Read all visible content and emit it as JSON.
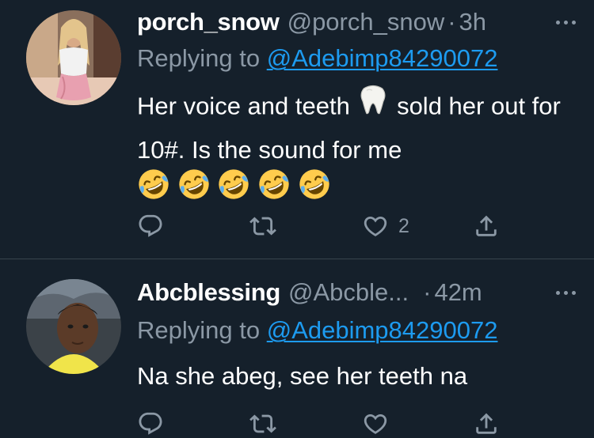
{
  "tweets": [
    {
      "display_name": "porch_snow",
      "handle": "@porch_snow",
      "separator": "·",
      "time": "3h",
      "replying_prefix": "Replying to ",
      "replying_to": "@Adebimp84290072",
      "text_part1": "Her voice and teeth ",
      "text_part2": " sold her out for 10#. Is the sound for me",
      "emojis": [
        "tooth",
        "rolling-on-floor-laughing",
        "rolling-on-floor-laughing",
        "rolling-on-floor-laughing",
        "rolling-on-floor-laughing",
        "rolling-on-floor-laughing"
      ],
      "like_count": "2",
      "icons": [
        "reply-icon",
        "retweet-icon",
        "like-icon",
        "share-icon",
        "more-icon"
      ]
    },
    {
      "display_name": "Abcblessing",
      "handle": "@Abcble...",
      "separator": "·",
      "time": "42m",
      "replying_prefix": "Replying to ",
      "replying_to": "@Adebimp84290072",
      "text": "Na she abeg, see her teeth na",
      "icons": [
        "reply-icon",
        "retweet-icon",
        "like-icon",
        "share-icon",
        "more-icon"
      ]
    }
  ],
  "colors": {
    "background": "#15202b",
    "primary_text": "#ffffff",
    "secondary_text": "#8b98a5",
    "mention": "#1d9bf0",
    "divider": "#38444d"
  }
}
